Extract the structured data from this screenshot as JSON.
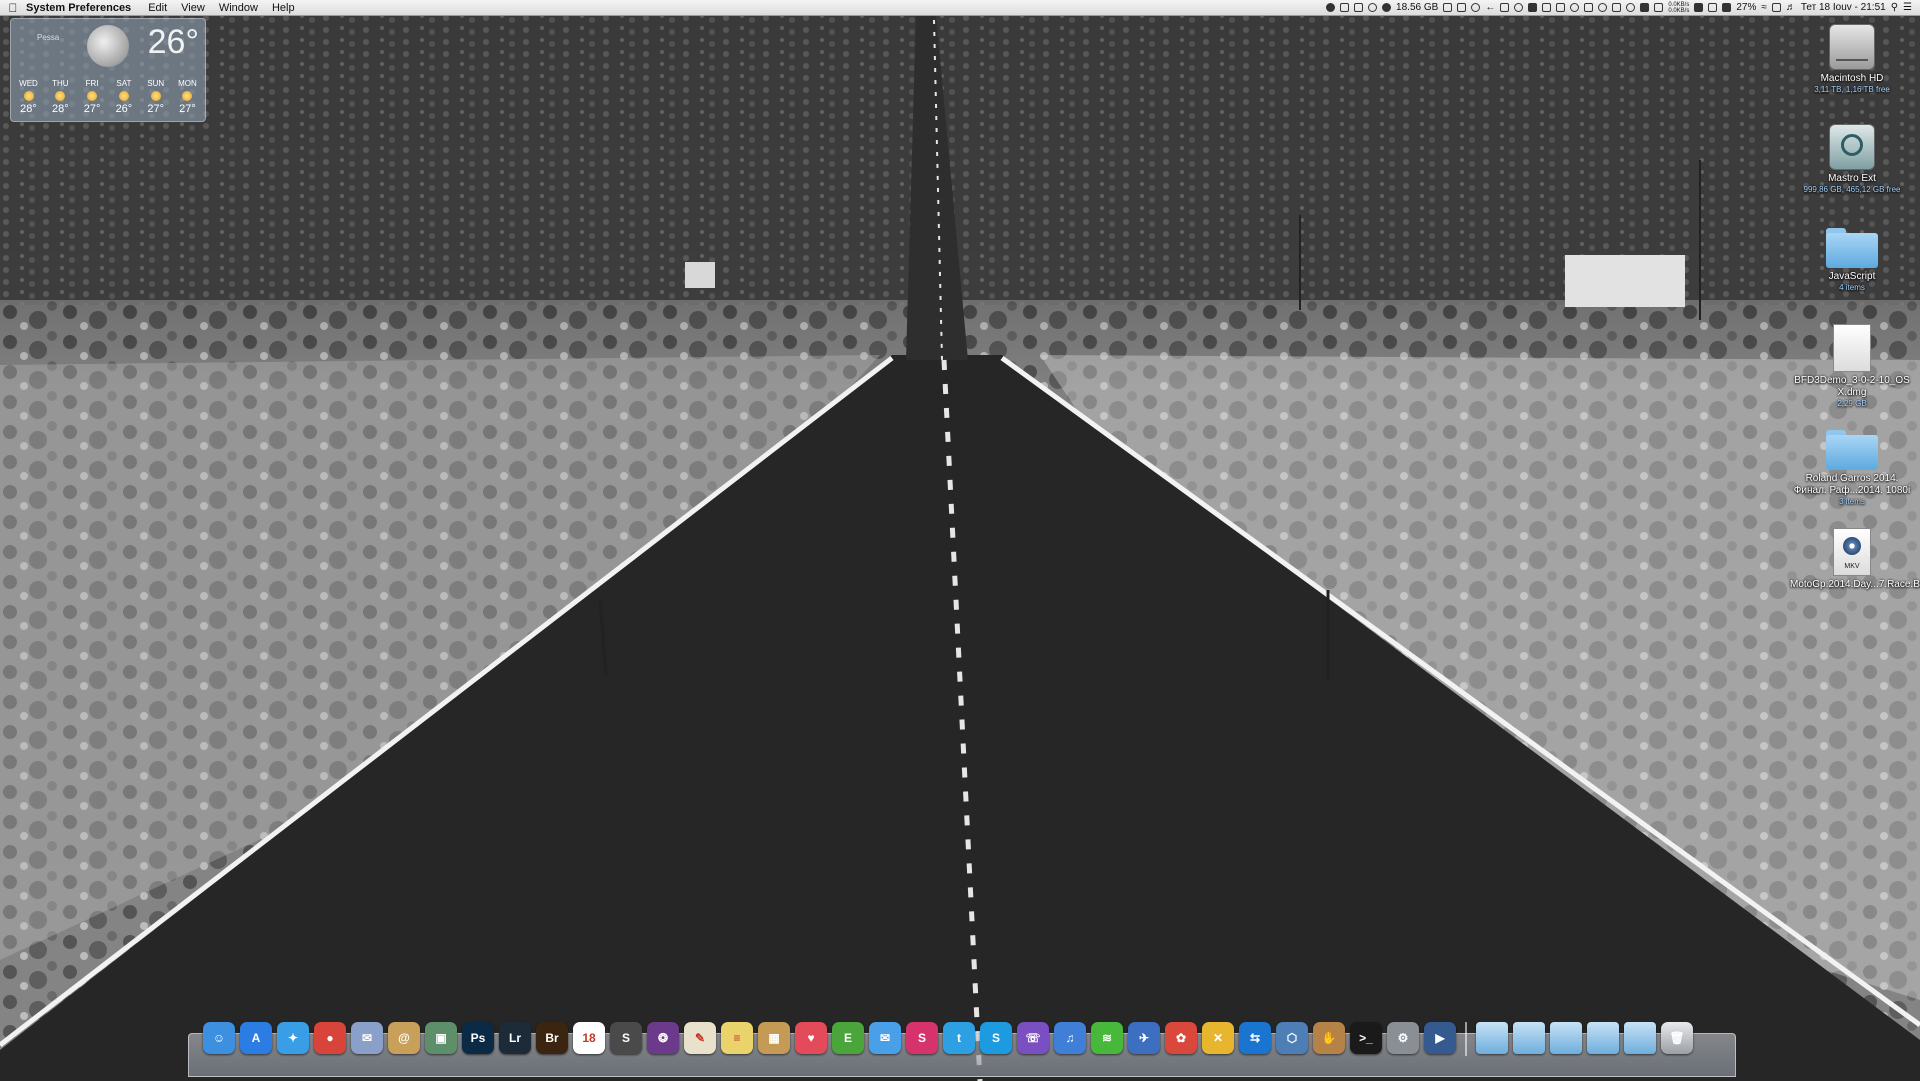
{
  "menubar": {
    "app_name": "System Preferences",
    "menus": [
      "Edit",
      "View",
      "Window",
      "Help"
    ],
    "disk_free": "18.56 GB",
    "net_up": "0.0KB/s",
    "net_down": "0.0KB/s",
    "battery": "27%",
    "clock": "Тет 18 Iouv - 21:51"
  },
  "weather": {
    "city": "Pessa",
    "current_temp": "26°",
    "forecast": [
      {
        "day": "WED",
        "temp": "28°"
      },
      {
        "day": "THU",
        "temp": "28°"
      },
      {
        "day": "FRI",
        "temp": "27°"
      },
      {
        "day": "SAT",
        "temp": "26°"
      },
      {
        "day": "SUN",
        "temp": "27°"
      },
      {
        "day": "MON",
        "temp": "27°"
      }
    ]
  },
  "desktop": {
    "items": [
      {
        "label": "Macintosh HD",
        "sub": "3,11 TB, 1,16 TB free",
        "icon": "hard-drive-icon"
      },
      {
        "label": "Mastro Ext",
        "sub": "999,86 GB, 465,12 GB free",
        "icon": "time-machine-drive-icon"
      },
      {
        "label": "JavaScript",
        "sub": "4 items",
        "icon": "folder-icon"
      },
      {
        "label": "BFD3Demo_3-0-2-10_OS X.dmg",
        "sub": "2,29 GB",
        "icon": "disk-image-icon"
      },
      {
        "label": "Roland Garros 2014. Финал. Раф...2014. 1080i",
        "sub": "3 items",
        "icon": "folder-icon"
      },
      {
        "label": "MotoGp.2014.Day...7.Race.Barc...R.Grt.Tv.mkv",
        "sub": "",
        "icon": "mkv-file-icon"
      }
    ]
  },
  "dock": {
    "apps": [
      {
        "name": "finder",
        "glyph": "☺",
        "color": "#3d8fe0"
      },
      {
        "name": "app-store",
        "glyph": "A",
        "color": "#2b7de3"
      },
      {
        "name": "safari",
        "glyph": "✦",
        "color": "#3a9ee6"
      },
      {
        "name": "chrome",
        "glyph": "●",
        "color": "#d9443a"
      },
      {
        "name": "mail-stamp",
        "glyph": "✉",
        "color": "#8aa0c8"
      },
      {
        "name": "contacts",
        "glyph": "@",
        "color": "#c8a05a"
      },
      {
        "name": "preview",
        "glyph": "▣",
        "color": "#5c8f6a"
      },
      {
        "name": "photoshop",
        "glyph": "Ps",
        "color": "#0b2a45"
      },
      {
        "name": "lightroom",
        "glyph": "Lr",
        "color": "#1d2b38"
      },
      {
        "name": "bridge",
        "glyph": "Br",
        "color": "#3b2410"
      },
      {
        "name": "calendar",
        "glyph": "18",
        "color": "#ffffff"
      },
      {
        "name": "sublime-text",
        "glyph": "S",
        "color": "#4a4a4a"
      },
      {
        "name": "colorsync",
        "glyph": "❂",
        "color": "#6b3a8a"
      },
      {
        "name": "textedit",
        "glyph": "✎",
        "color": "#e8e2cc"
      },
      {
        "name": "notes",
        "glyph": "≡",
        "color": "#e9d36a"
      },
      {
        "name": "archive-utility",
        "glyph": "▦",
        "color": "#c59a55"
      },
      {
        "name": "pocket",
        "glyph": "♥",
        "color": "#e44b5a"
      },
      {
        "name": "evernote",
        "glyph": "E",
        "color": "#4aa53a"
      },
      {
        "name": "messages",
        "glyph": "✉",
        "color": "#4aa0e8"
      },
      {
        "name": "skitch",
        "glyph": "S",
        "color": "#d6336c"
      },
      {
        "name": "twitter",
        "glyph": "t",
        "color": "#2d9fe3"
      },
      {
        "name": "skype",
        "glyph": "S",
        "color": "#1d9be0"
      },
      {
        "name": "viber",
        "glyph": "☏",
        "color": "#7a4fc2"
      },
      {
        "name": "itunes",
        "glyph": "♫",
        "color": "#3f7fd8"
      },
      {
        "name": "spotify",
        "glyph": "≋",
        "color": "#47b83a"
      },
      {
        "name": "cyberduck",
        "glyph": "✈",
        "color": "#3c6fc0"
      },
      {
        "name": "popcorn-time",
        "glyph": "✿",
        "color": "#d9483b"
      },
      {
        "name": "x-tool",
        "glyph": "✕",
        "color": "#e8b52e"
      },
      {
        "name": "teamviewer",
        "glyph": "⇆",
        "color": "#1a75d1"
      },
      {
        "name": "virtualbox",
        "glyph": "⬡",
        "color": "#4d7fb6"
      },
      {
        "name": "packages",
        "glyph": "✋",
        "color": "#b58348"
      },
      {
        "name": "terminal",
        "glyph": ">_",
        "color": "#1a1a1a"
      },
      {
        "name": "system-preferences",
        "glyph": "⚙",
        "color": "#8a8f96"
      },
      {
        "name": "quicktime",
        "glyph": "▶",
        "color": "#345a8f"
      }
    ],
    "stacks": [
      {
        "name": "applications-stack"
      },
      {
        "name": "documents-stack"
      },
      {
        "name": "desktop-stack"
      },
      {
        "name": "downloads-stack"
      },
      {
        "name": "pictures-stack"
      }
    ],
    "trash": {
      "name": "trash",
      "glyph": "🗑"
    }
  }
}
